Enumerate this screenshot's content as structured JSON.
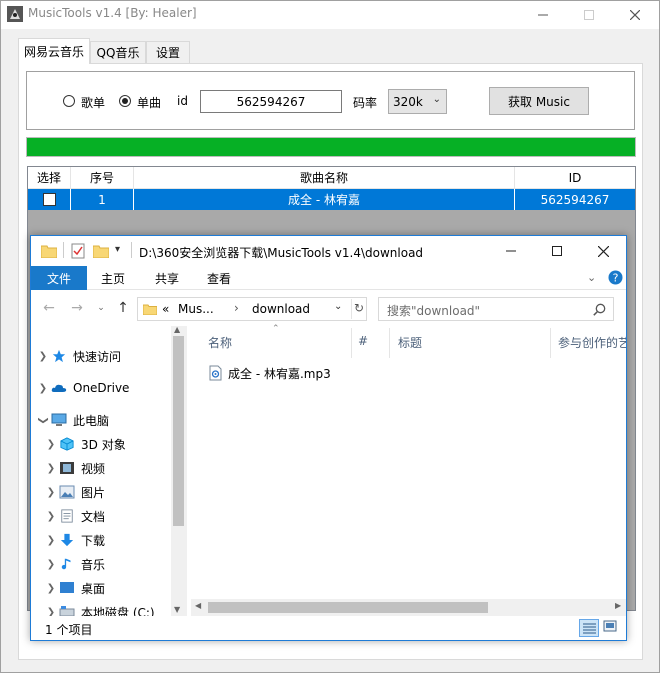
{
  "app": {
    "title": "MusicTools v1.4 [By:  Healer]",
    "tabs": [
      "网易云音乐",
      "QQ音乐",
      "设置"
    ],
    "mode_options": [
      "歌单",
      "单曲"
    ],
    "selected_mode": "单曲",
    "id_label": "id",
    "id_value": "562594267",
    "bitrate_label": "码率",
    "bitrate_value": "320k",
    "fetch_button": "获取 Music",
    "progress_fraction": 1.0,
    "progress_color": "#06b025",
    "table": {
      "columns": [
        "选择",
        "序号",
        "歌曲名称",
        "ID"
      ],
      "rows": [
        {
          "checked": false,
          "index": "1",
          "name": "成全 - 林宥嘉",
          "id": "562594267"
        }
      ]
    }
  },
  "explorer": {
    "path": "D:\\360安全浏览器下载\\MusicTools v1.4\\download",
    "ribbon_tabs": [
      "文件",
      "主页",
      "共享",
      "查看"
    ],
    "breadcrumb": [
      "«",
      "Mus...",
      "download"
    ],
    "search_placeholder": "搜索\"download\"",
    "nav_items": [
      {
        "label": "快速访问",
        "icon": "star-icon"
      },
      {
        "label": "OneDrive",
        "icon": "cloud-icon"
      },
      {
        "label": "此电脑",
        "icon": "computer-icon"
      },
      {
        "label": "3D 对象",
        "icon": "cube-icon"
      },
      {
        "label": "视频",
        "icon": "video-icon"
      },
      {
        "label": "图片",
        "icon": "picture-icon"
      },
      {
        "label": "文档",
        "icon": "document-icon"
      },
      {
        "label": "下载",
        "icon": "download-icon"
      },
      {
        "label": "音乐",
        "icon": "music-icon"
      },
      {
        "label": "桌面",
        "icon": "desktop-icon"
      },
      {
        "label": "本地磁盘 (C:)",
        "icon": "drive-icon"
      }
    ],
    "columns": [
      "名称",
      "#",
      "标题",
      "参与创作的艺"
    ],
    "files": [
      {
        "name": "成全 - 林宥嘉.mp3",
        "icon": "audio-file-icon"
      }
    ],
    "status": "1 个项目"
  }
}
